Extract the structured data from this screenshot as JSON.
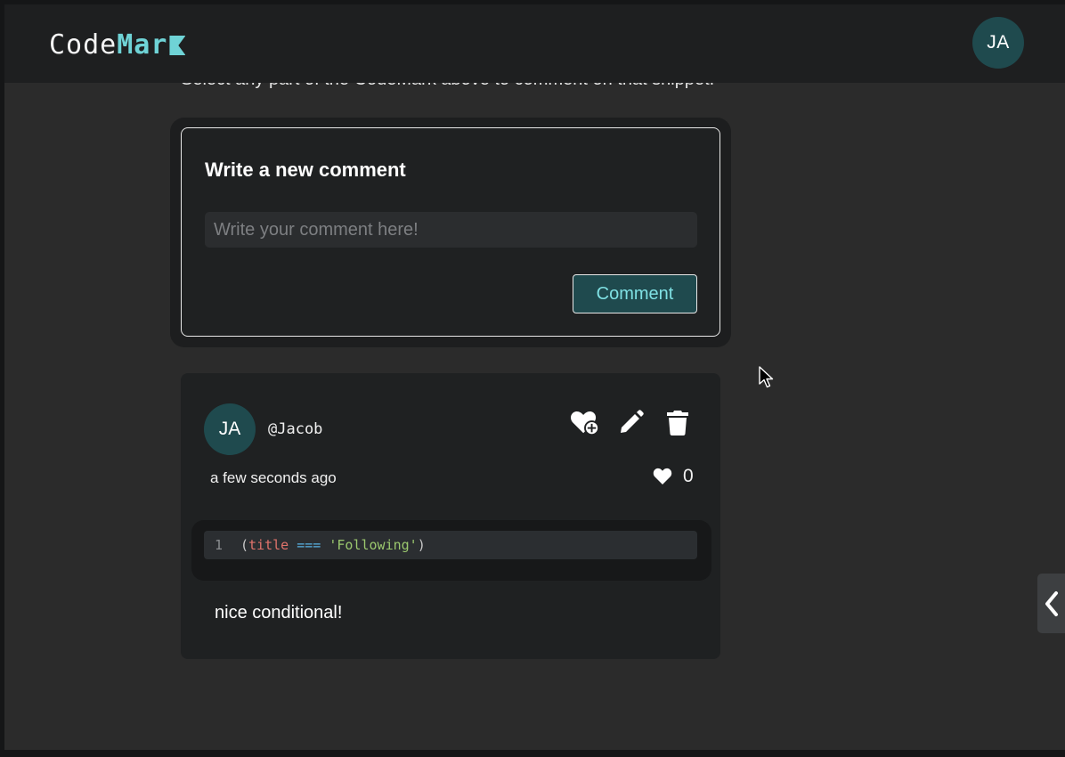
{
  "navbar": {
    "logo_prefix": "Code",
    "logo_accent": "Mar",
    "user_initials": "JA"
  },
  "hint_text": "Select any part of the CodeMark above to comment on that snippet.",
  "new_comment": {
    "heading": "Write a new comment",
    "placeholder": "Write your comment here!",
    "value": "",
    "submit_label": "Comment"
  },
  "comment": {
    "initials": "JA",
    "username": "@Jacob",
    "timestamp": "a few seconds ago",
    "like_count": "0",
    "code": {
      "line_number": "1",
      "tokens": [
        "(",
        "title",
        " === ",
        "'Following'",
        ")"
      ]
    },
    "text": "nice conditional!",
    "actions": [
      "heart-plus-icon",
      "pencil-icon",
      "trash-icon"
    ]
  },
  "colors": {
    "background": "#2b2b2b",
    "navbar": "#1e1f20",
    "card": "#1f2122",
    "accent": "#6fd3d6",
    "avatar": "#1f4a4e"
  }
}
